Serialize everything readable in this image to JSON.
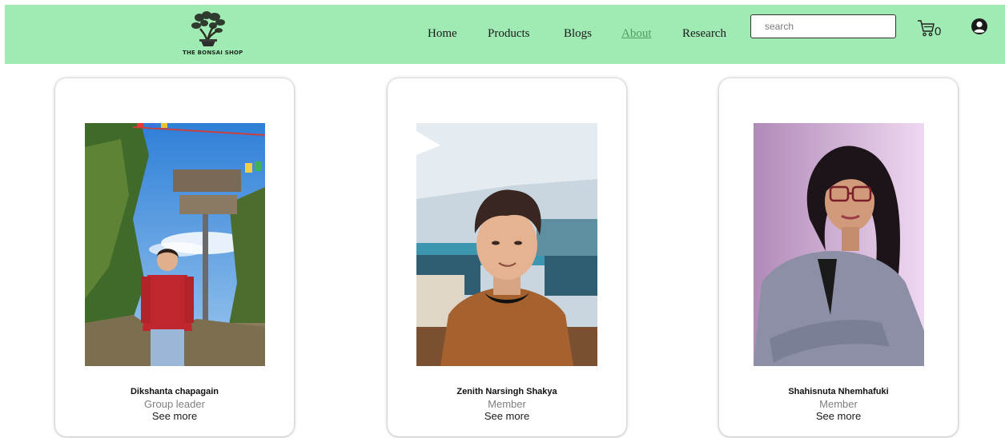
{
  "brand": {
    "logo_text": "THE BONSAI SHOP",
    "logo_icon": "bonsai-tree-icon"
  },
  "nav": {
    "items": [
      {
        "label": "Home",
        "active": false
      },
      {
        "label": "Products",
        "active": false
      },
      {
        "label": "Blogs",
        "active": false
      },
      {
        "label": "About",
        "active": true
      },
      {
        "label": "Research",
        "active": false
      }
    ]
  },
  "search": {
    "placeholder": "search",
    "value": ""
  },
  "cart": {
    "icon": "cart-icon",
    "count": "0"
  },
  "account": {
    "icon": "user-avatar-icon"
  },
  "team": [
    {
      "name": "Dikshanta chapagain",
      "role": "Group leader",
      "more": "See more"
    },
    {
      "name": "Zenith Narsingh Shakya",
      "role": "Member",
      "more": "See more"
    },
    {
      "name": "Shahisnuta Nhemhafuki",
      "role": "Member",
      "more": "See more"
    }
  ],
  "colors": {
    "navbar_bg": "#a0eab3",
    "active_link": "#4f9e5f",
    "role_text": "#7f7f7f"
  }
}
